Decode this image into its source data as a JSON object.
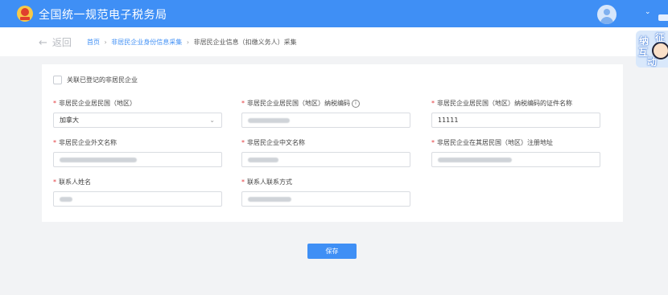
{
  "header": {
    "app_title": "全国统一规范电子税务局",
    "logo_icon": "tax-emblem-icon",
    "avatar_icon": "user-avatar-icon",
    "dropdown_icon": "chevron-down-icon",
    "brand_color": "#3f8ff5"
  },
  "breadcrumb": {
    "back_label": "返回",
    "items": [
      "首页",
      "非居民企业身份信息采集"
    ],
    "current": "非居民企业信息（扣缴义务人）采集",
    "separator": "›"
  },
  "widget": {
    "chars": [
      "纳",
      "征",
      "互",
      "动"
    ]
  },
  "form": {
    "associate_label": "关联已登记的非居民企业",
    "associate_checked": false,
    "fields": {
      "residence_country": {
        "label": "非居民企业居民国（地区）",
        "value": "加拿大",
        "type": "select"
      },
      "tax_id": {
        "label": "非居民企业居民国（地区）纳税编码",
        "value": ""
      },
      "tax_id_cert_name": {
        "label": "非居民企业居民国（地区）纳税编码的证件名称",
        "value": "11111"
      },
      "foreign_name": {
        "label": "非居民企业外文名称",
        "value": ""
      },
      "chinese_name": {
        "label": "非居民企业中文名称",
        "value": ""
      },
      "registered_address": {
        "label": "非居民企业在其居民国（地区）注册地址",
        "value": ""
      },
      "contact_name": {
        "label": "联系人姓名",
        "value": ""
      },
      "contact_info": {
        "label": "联系人联系方式",
        "value": ""
      }
    },
    "required_marker": "*",
    "save_label": "保存"
  }
}
